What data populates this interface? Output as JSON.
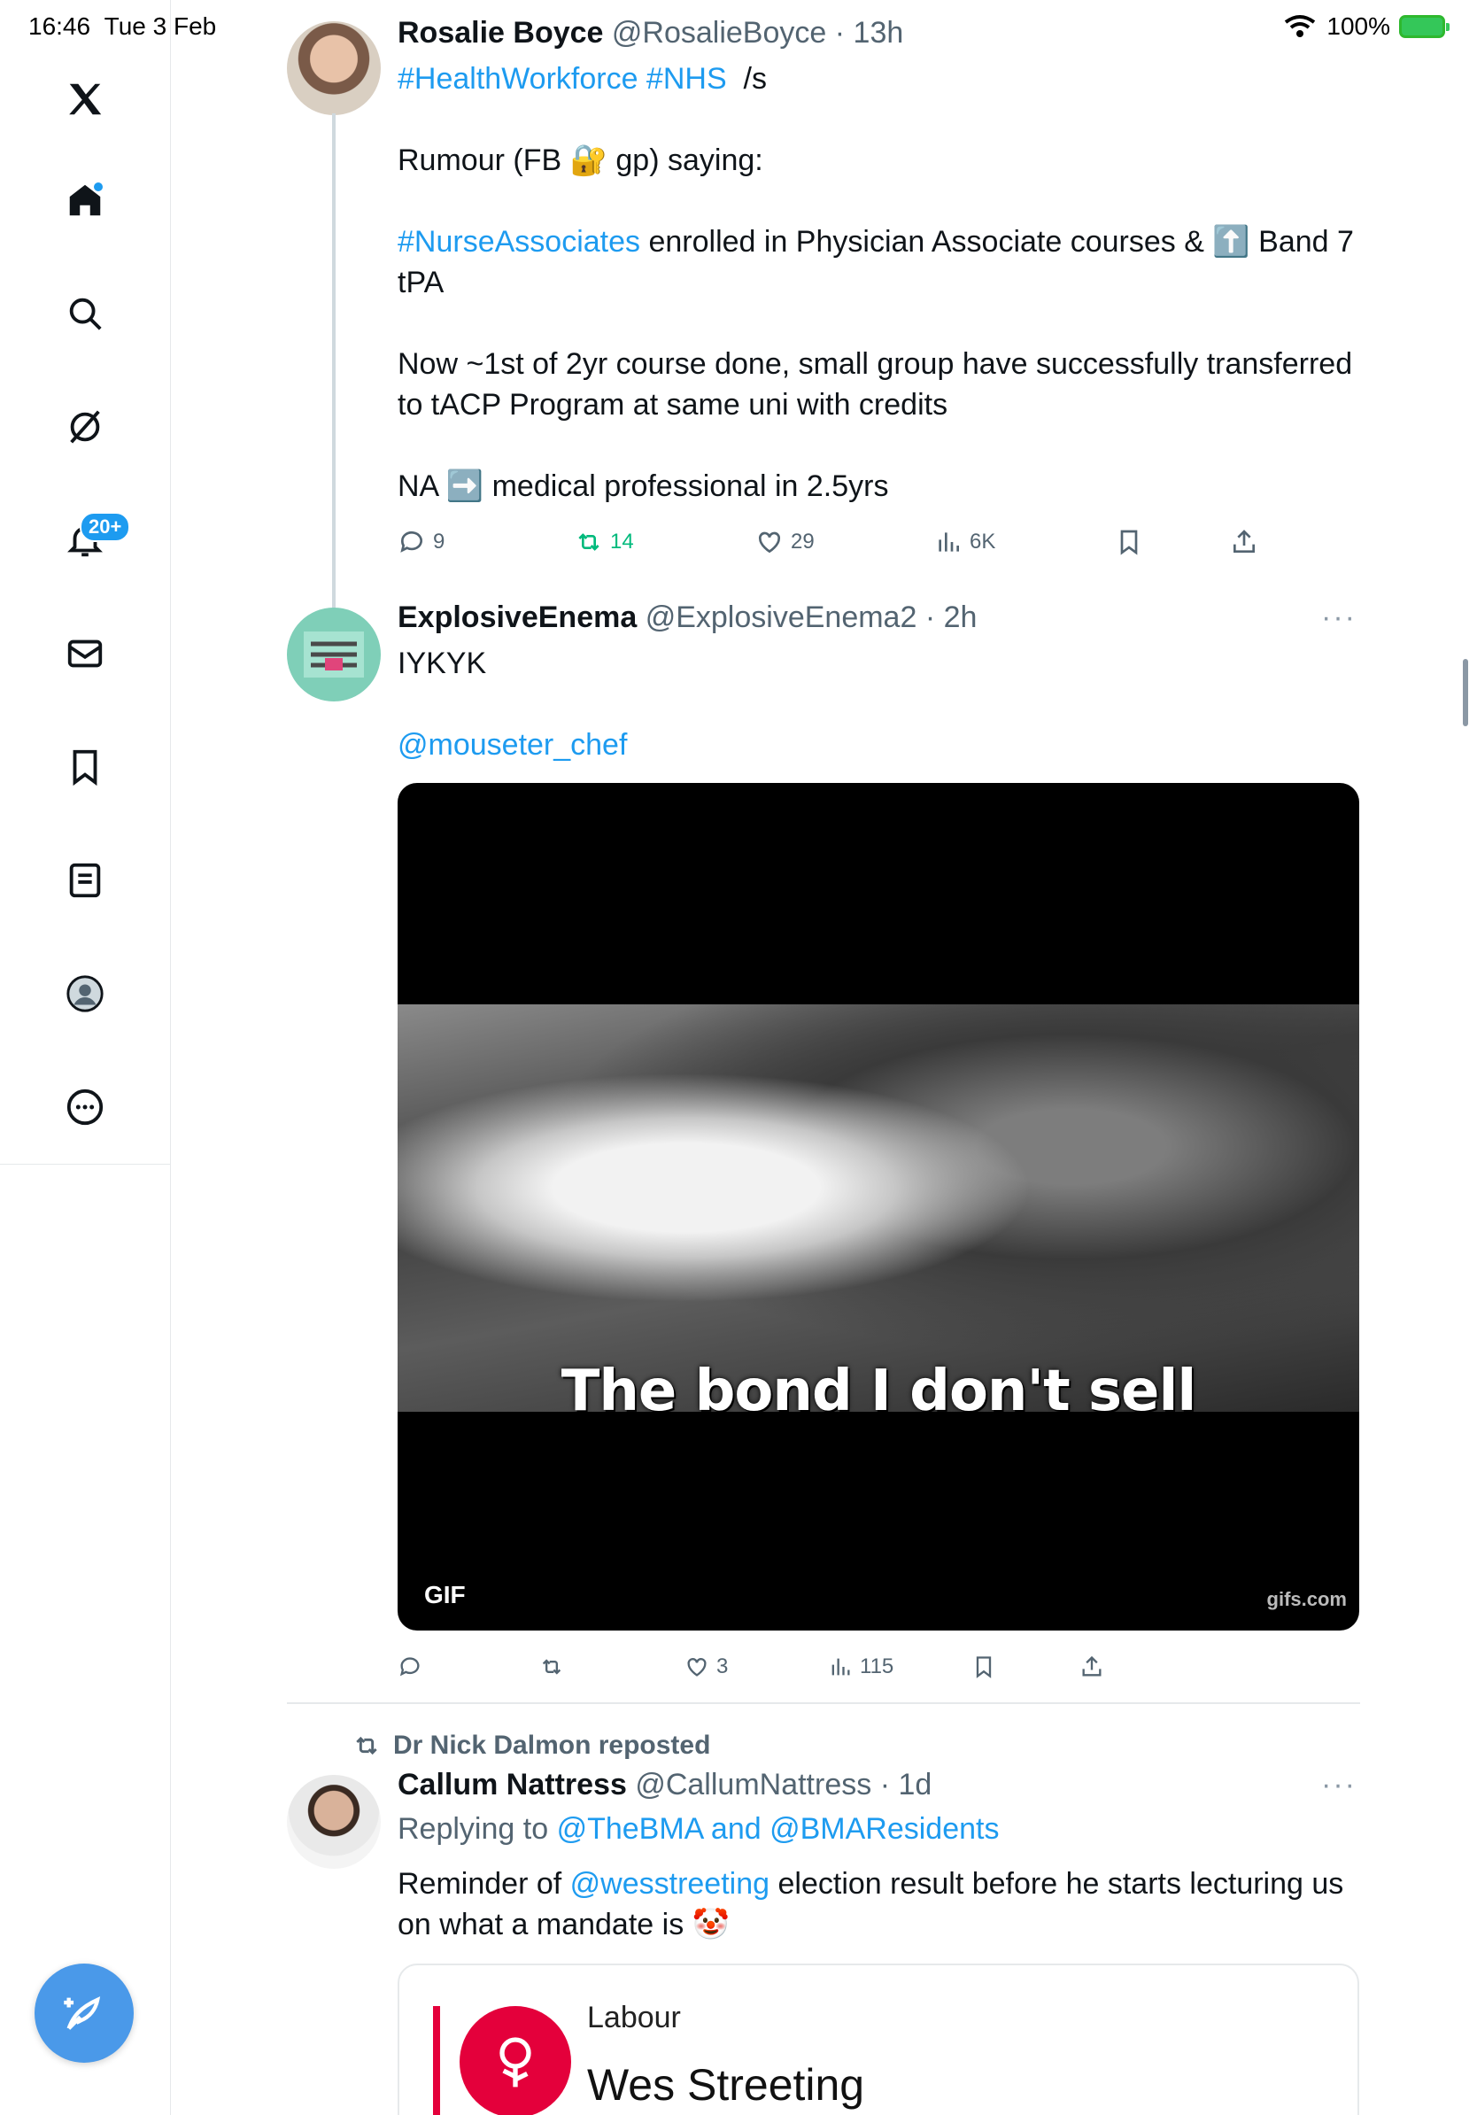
{
  "status": {
    "time": "16:46",
    "date": "Tue 3 Feb",
    "battery": "100%"
  },
  "sidebar": {
    "notif_badge": "20+"
  },
  "tweets": [
    {
      "name": "Rosalie Boyce",
      "handle": "@RosalieBoyce",
      "age": "13h",
      "line1_tags": "#HealthWorkforce #NHS",
      "line1_suffix": "/s",
      "p1_a": "Rumour (FB",
      "p1_emoji": "🔐",
      "p1_b": "gp) saying:",
      "p2_tag": "#NurseAssociates",
      "p2_a": "enrolled in Physician Associate courses &",
      "p2_emoji": "⬆️",
      "p2_b": "Band 7 tPA",
      "p3": "Now ~1st of 2yr course done, small group have successfully transferred to tACP Program at same uni with credits",
      "p4_a": "NA",
      "p4_emoji": "➡️",
      "p4_b": "medical professional in 2.5yrs",
      "replies": "9",
      "reposts": "14",
      "likes": "29",
      "views": "6K"
    },
    {
      "name": "ExplosiveEnema",
      "handle": "@ExplosiveEnema2",
      "age": "2h",
      "text": "IYKYK",
      "mention": "@mouseter_chef",
      "media_caption": "The bond I don't sell",
      "media_label": "GIF",
      "media_watermark": "gifs.com",
      "likes": "3",
      "views": "115"
    },
    {
      "repost_by": "Dr Nick Dalmon reposted",
      "name": "Callum Nattress",
      "handle": "@CallumNattress",
      "age": "1d",
      "replying_label": "Replying to",
      "replying_to": "@TheBMA and @BMAResidents",
      "text_a": "Reminder of",
      "mention": "@wesstreeting",
      "text_b": "election result before he starts lecturing us on what a mandate is",
      "emoji": "🤡",
      "card_party": "Labour",
      "card_candidate": "Wes Streeting"
    }
  ]
}
